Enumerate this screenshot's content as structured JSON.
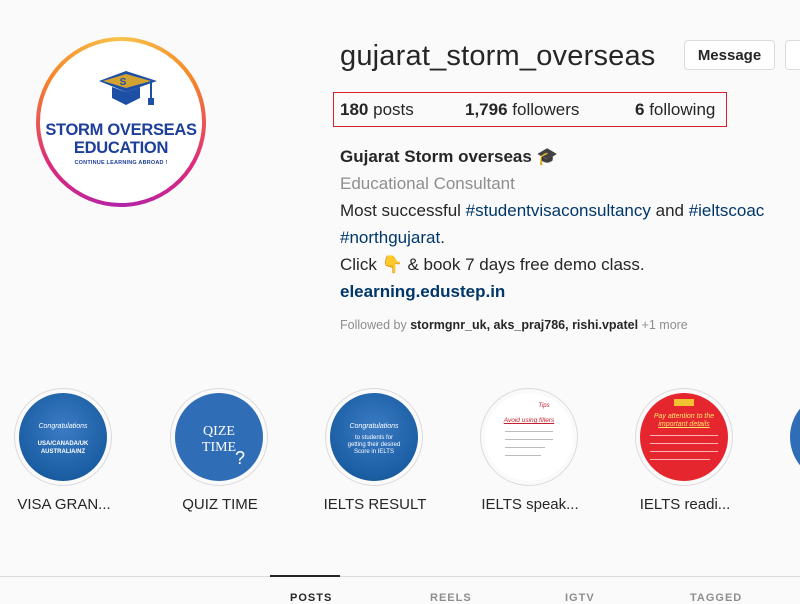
{
  "profile": {
    "username": "gujarat_storm_overseas",
    "message_label": "Message",
    "stats": {
      "posts_count": "180",
      "posts_label": "posts",
      "followers_count": "1,796",
      "followers_label": "followers",
      "following_count": "6",
      "following_label": "following"
    },
    "name": "Gujarat Storm overseas 🎓",
    "category": "Educational Consultant",
    "bio": {
      "line1_prefix": "Most successful ",
      "tag1": "#studentvisaconsultancy",
      "and": " and ",
      "tag2": "#ieltscoac",
      "tag3": "#northgujarat",
      "tag3_suffix": ".",
      "line3": "Click 👇 & book 7 days free demo class.",
      "link": "elearning.edustep.in"
    },
    "followed_by": {
      "prefix": "Followed by ",
      "users": "stormgnr_uk, aks_praj786, rishi.vpatel",
      "more": " +1 more"
    }
  },
  "avatar_logo": {
    "line1": "STORM OVERSEAS",
    "line2": "EDUCATION",
    "tagline": "CONTINUE LEARNING ABROAD !"
  },
  "highlights": [
    {
      "label": "VISA GRAN...",
      "lines": [
        "Congratulations",
        "USA/CANADA/UK",
        "AUSTRALIA/NZ"
      ]
    },
    {
      "label": "QUIZ TIME",
      "lines": [
        "QIZE",
        "TIME"
      ]
    },
    {
      "label": "IELTS RESULT",
      "lines": [
        "Congratulations",
        "to students for",
        "getting their desired",
        "Score in IELTS"
      ]
    },
    {
      "label": "IELTS speak...",
      "lines": [
        "Tips",
        "Avoid using fillers"
      ]
    },
    {
      "label": "IELTS readi...",
      "lines": [
        "Pay attention to the",
        "important details"
      ]
    }
  ],
  "tabs": [
    "POSTS",
    "REELS",
    "IGTV",
    "TAGGED"
  ],
  "colors": {
    "accent_red": "#d91f2a",
    "link_blue": "#00376b",
    "logo_blue": "#1d3f9a"
  }
}
